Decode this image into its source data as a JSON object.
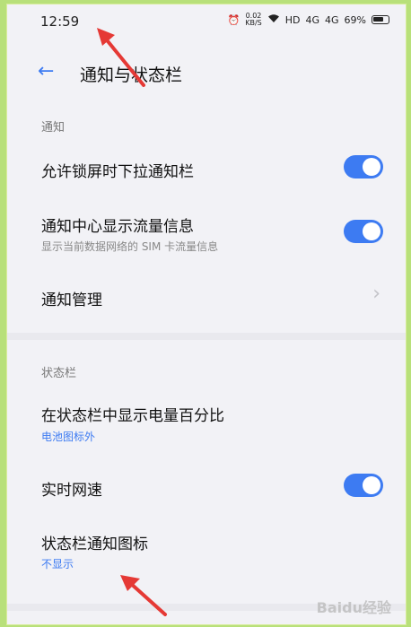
{
  "status_bar": {
    "time": "12:59",
    "net_speed": "0.02",
    "net_unit": "KB/S",
    "hd": "HD",
    "sig1": "4G",
    "sig2": "4G",
    "battery": "69%"
  },
  "header": {
    "title": "通知与状态栏"
  },
  "sections": {
    "notify": {
      "label": "通知",
      "allow_lock": "允许锁屏时下拉通知栏",
      "traffic_title": "通知中心显示流量信息",
      "traffic_sub": "显示当前数据网络的 SIM 卡流量信息",
      "manage": "通知管理"
    },
    "statusbar": {
      "label": "状态栏",
      "battery_title": "在状态栏中显示电量百分比",
      "battery_value": "电池图标外",
      "speed_title": "实时网速",
      "notif_icon_title": "状态栏通知图标",
      "notif_icon_value": "不显示"
    }
  },
  "watermark": "Baidu经验",
  "colors": {
    "accent": "#3d7bf2",
    "arrow": "#e53935",
    "border": "#b8e07a"
  }
}
